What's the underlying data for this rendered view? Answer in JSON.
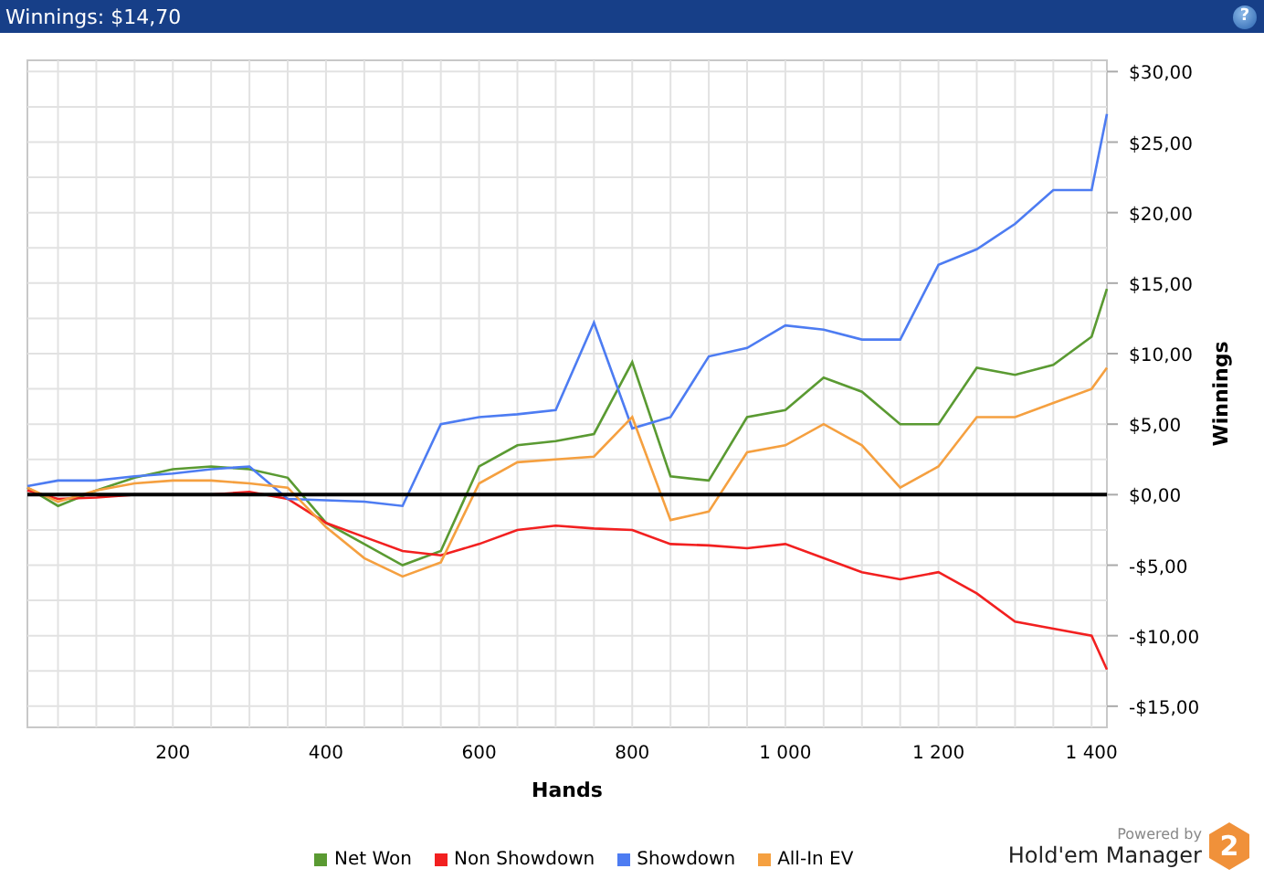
{
  "window": {
    "title": "Winnings: $14,70",
    "help_button": "?"
  },
  "chart": {
    "chart_data": {
      "type": "line",
      "grid": true,
      "xlabel": "Hands",
      "ylabel": "Winnings",
      "xlim": [
        10,
        1420
      ],
      "ylim": [
        -16.5,
        30.8
      ],
      "x": [
        10,
        50,
        100,
        150,
        200,
        250,
        300,
        350,
        400,
        450,
        500,
        550,
        600,
        650,
        700,
        750,
        800,
        850,
        900,
        950,
        1000,
        1050,
        1100,
        1150,
        1200,
        1250,
        1300,
        1350,
        1400,
        1420
      ],
      "xticks": [
        {
          "value": 200,
          "label": "200"
        },
        {
          "value": 400,
          "label": "400"
        },
        {
          "value": 600,
          "label": "600"
        },
        {
          "value": 800,
          "label": "800"
        },
        {
          "value": 1000,
          "label": "1 000"
        },
        {
          "value": 1200,
          "label": "1 200"
        },
        {
          "value": 1400,
          "label": "1 400"
        }
      ],
      "yticks": [
        {
          "value": 30,
          "label": "$30,00"
        },
        {
          "value": 25,
          "label": "$25,00"
        },
        {
          "value": 20,
          "label": "$20,00"
        },
        {
          "value": 15,
          "label": "$15,00"
        },
        {
          "value": 10,
          "label": "$10,00"
        },
        {
          "value": 5,
          "label": "$5,00"
        },
        {
          "value": 0,
          "label": "$0,00"
        },
        {
          "value": -5,
          "label": "-$5,00"
        },
        {
          "value": -10,
          "label": "-$10,00"
        },
        {
          "value": -15,
          "label": "-$15,00"
        }
      ],
      "series": [
        {
          "name": "Net Won",
          "color": "#5a9a32",
          "values": [
            0.5,
            -0.8,
            0.3,
            1.2,
            1.8,
            2,
            1.8,
            1.2,
            -2,
            -3.5,
            -5,
            -4,
            2,
            3.5,
            3.8,
            4.3,
            9.4,
            1.3,
            1,
            5.5,
            6,
            8.3,
            7.3,
            5,
            5,
            9,
            8.5,
            9.2,
            11.2,
            14.6
          ]
        },
        {
          "name": "Non Showdown",
          "color": "#f22020",
          "values": [
            0.3,
            -0.3,
            -0.2,
            0,
            0,
            0,
            0.2,
            -0.3,
            -2,
            -3,
            -4,
            -4.3,
            -3.5,
            -2.5,
            -2.2,
            -2.4,
            -2.5,
            -3.5,
            -3.6,
            -3.8,
            -3.5,
            -4.5,
            -5.5,
            -6,
            -5.5,
            -7,
            -9,
            -9.5,
            -10,
            -12.4
          ]
        },
        {
          "name": "Showdown",
          "color": "#4d7cf2",
          "values": [
            0.6,
            1,
            1,
            1.3,
            1.5,
            1.8,
            2,
            -0.3,
            -0.4,
            -0.5,
            -0.8,
            5,
            5.5,
            5.7,
            6,
            12.2,
            4.7,
            5.5,
            9.8,
            10.4,
            12,
            11.7,
            11,
            11,
            16.3,
            17.4,
            19.2,
            21.6,
            21.6,
            27
          ]
        },
        {
          "name": "All-In EV",
          "color": "#f5a040",
          "values": [
            0.5,
            -0.5,
            0.3,
            0.8,
            1,
            1,
            0.8,
            0.5,
            -2.3,
            -4.5,
            -5.8,
            -4.8,
            0.8,
            2.3,
            2.5,
            2.7,
            5.5,
            -1.8,
            -1.2,
            3,
            3.5,
            5,
            3.5,
            0.5,
            2,
            5.5,
            5.5,
            6.5,
            7.5,
            9
          ]
        }
      ]
    }
  },
  "branding": {
    "powered_by": "Powered by",
    "product": "Hold'em Manager",
    "badge": "2"
  }
}
